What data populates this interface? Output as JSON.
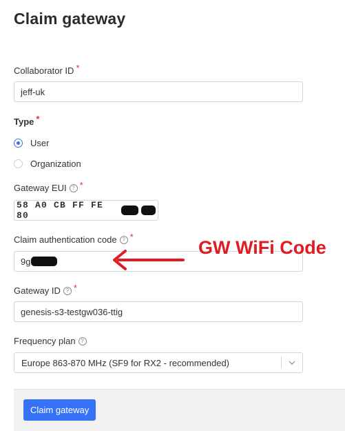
{
  "page": {
    "title": "Claim gateway"
  },
  "form": {
    "collaborator_id": {
      "label": "Collaborator ID",
      "value": "jeff-uk"
    },
    "type": {
      "label": "Type",
      "options": [
        {
          "label": "User",
          "selected": true
        },
        {
          "label": "Organization",
          "selected": false
        }
      ]
    },
    "gateway_eui": {
      "label": "Gateway EUI",
      "value": "58 A0 CB FF FE 80"
    },
    "claim_auth_code": {
      "label": "Claim authentication code",
      "value": "9g"
    },
    "gateway_id": {
      "label": "Gateway ID",
      "value": "genesis-s3-testgw036-ttig"
    },
    "frequency_plan": {
      "label": "Frequency plan",
      "value": "Europe 863-870 MHz (SF9 for RX2 - recommended)"
    }
  },
  "footer": {
    "submit_label": "Claim gateway"
  },
  "annotation": {
    "text": "GW WiFi Code",
    "color": "#e11b22"
  },
  "colors": {
    "accent": "#3572f5",
    "required": "#e0322d"
  },
  "icons": {
    "help": "question-circle-icon",
    "dropdown": "chevron-down-icon"
  }
}
